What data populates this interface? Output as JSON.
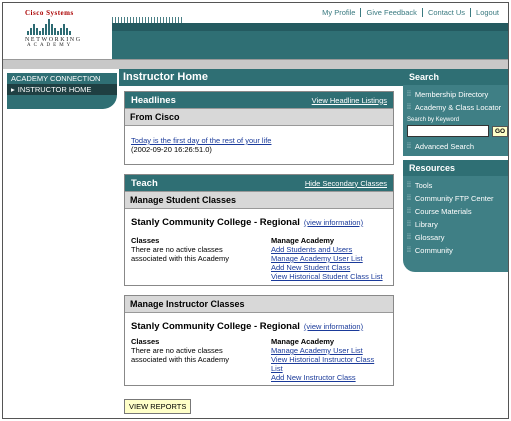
{
  "header": {
    "logo": {
      "company": "Cisco Systems",
      "line1": "NETWORKING",
      "line2": "ACADEMY"
    },
    "topnav": [
      "My Profile",
      "Give Feedback",
      "Contact Us",
      "Logout"
    ]
  },
  "leftnav": {
    "section": "ACADEMY CONNECTION",
    "active_item": "INSTRUCTOR HOME"
  },
  "main": {
    "title": "Instructor Home",
    "headlines": {
      "title": "Headlines",
      "link": "View Headline Listings",
      "subhead": "From Cisco",
      "item_text": "Today is the first day of the rest of your life",
      "item_date": "(2002-09-20 16:26:51.0)"
    },
    "teach": {
      "title": "Teach",
      "link": "Hide Secondary Classes",
      "student": {
        "subhead": "Manage Student Classes",
        "college": "Stanly Community College - Regional",
        "info": "(view information)",
        "classes_label": "Classes",
        "classes_text": "There are no active classes associated with this Academy",
        "manage_label": "Manage Academy",
        "links": [
          "Add Students and Users",
          "Manage Academy User List",
          "Add New Student Class",
          "View Historical Student Class List"
        ]
      }
    },
    "instructor": {
      "subhead": "Manage Instructor Classes",
      "college": "Stanly Community College - Regional",
      "info": "(view information)",
      "classes_label": "Classes",
      "classes_text": "There are no active classes associated with this Academy",
      "manage_label": "Manage Academy",
      "links": [
        "Manage Academy User List",
        "View Historical Instructor Class List",
        "Add New Instructor Class"
      ]
    },
    "reports_button": "VIEW REPORTS"
  },
  "right": {
    "search": {
      "title": "Search",
      "items": [
        "Membership Directory",
        "Academy & Class Locator"
      ],
      "keyword_label": "Search by Keyword",
      "keyword_value": "",
      "go": "GO",
      "advanced": "Advanced Search"
    },
    "resources": {
      "title": "Resources",
      "items": [
        "Tools",
        "Community FTP Center",
        "Course Materials",
        "Library",
        "Glossary",
        "Community"
      ]
    }
  },
  "colors": {
    "teal": "#2f6f74",
    "teal_light": "#3f7f85",
    "link": "#1a3a9a",
    "highlight": "#ffffc8"
  }
}
